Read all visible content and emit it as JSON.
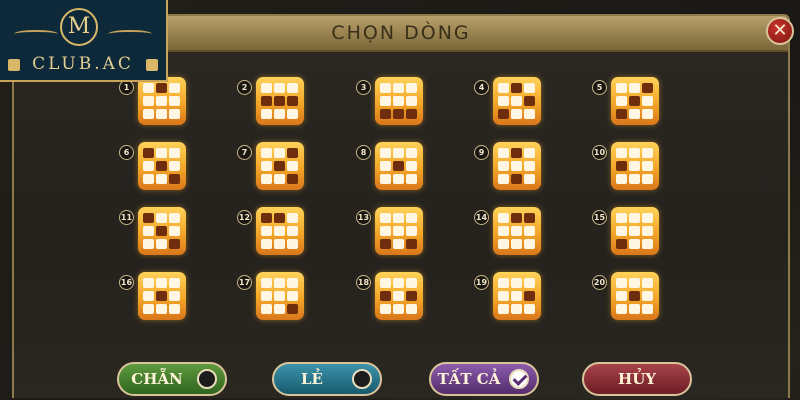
{
  "logo": {
    "monogram": "M",
    "brand": "CLUB.AC"
  },
  "dialog": {
    "title": "CHỌN DÒNG",
    "close_label": "✕"
  },
  "lines": [
    {
      "number": "1",
      "pattern": [
        1,
        0,
        1,
        1,
        1,
        1,
        1,
        1,
        1
      ]
    },
    {
      "number": "2",
      "pattern": [
        1,
        1,
        1,
        0,
        0,
        0,
        1,
        1,
        1
      ]
    },
    {
      "number": "3",
      "pattern": [
        1,
        1,
        1,
        1,
        1,
        1,
        0,
        0,
        0
      ]
    },
    {
      "number": "4",
      "pattern": [
        1,
        0,
        1,
        1,
        1,
        0,
        0,
        1,
        1
      ]
    },
    {
      "number": "5",
      "pattern": [
        1,
        1,
        0,
        1,
        0,
        1,
        0,
        1,
        1
      ]
    },
    {
      "number": "6",
      "pattern": [
        0,
        1,
        1,
        1,
        0,
        1,
        1,
        1,
        0
      ]
    },
    {
      "number": "7",
      "pattern": [
        1,
        1,
        0,
        1,
        0,
        1,
        1,
        1,
        0
      ]
    },
    {
      "number": "8",
      "pattern": [
        1,
        1,
        1,
        1,
        0,
        1,
        1,
        1,
        1
      ]
    },
    {
      "number": "9",
      "pattern": [
        1,
        0,
        1,
        1,
        1,
        1,
        1,
        0,
        1
      ]
    },
    {
      "number": "10",
      "pattern": [
        1,
        1,
        1,
        0,
        1,
        1,
        1,
        1,
        1
      ]
    },
    {
      "number": "11",
      "pattern": [
        0,
        1,
        1,
        1,
        0,
        1,
        1,
        1,
        0
      ]
    },
    {
      "number": "12",
      "pattern": [
        0,
        0,
        1,
        1,
        1,
        1,
        1,
        1,
        1
      ]
    },
    {
      "number": "13",
      "pattern": [
        1,
        1,
        1,
        1,
        1,
        1,
        0,
        1,
        0
      ]
    },
    {
      "number": "14",
      "pattern": [
        1,
        0,
        0,
        1,
        1,
        1,
        1,
        1,
        1
      ]
    },
    {
      "number": "15",
      "pattern": [
        1,
        1,
        1,
        1,
        1,
        1,
        0,
        1,
        1
      ]
    },
    {
      "number": "16",
      "pattern": [
        1,
        1,
        1,
        1,
        0,
        1,
        1,
        1,
        1
      ]
    },
    {
      "number": "17",
      "pattern": [
        1,
        1,
        1,
        1,
        1,
        1,
        1,
        1,
        0
      ]
    },
    {
      "number": "18",
      "pattern": [
        1,
        1,
        1,
        0,
        1,
        0,
        1,
        1,
        1
      ]
    },
    {
      "number": "19",
      "pattern": [
        1,
        1,
        1,
        1,
        1,
        0,
        1,
        1,
        1
      ]
    },
    {
      "number": "20",
      "pattern": [
        1,
        1,
        1,
        1,
        0,
        1,
        1,
        1,
        1
      ]
    }
  ],
  "buttons": {
    "even": {
      "label": "CHẴN",
      "color": "#3f7a2a"
    },
    "odd": {
      "label": "LẺ",
      "color": "#1f6f86"
    },
    "all": {
      "label": "TẤT CẢ",
      "color": "#6a3b86",
      "checked": true
    },
    "cancel": {
      "label": "HỦY",
      "color": "#8a2c33"
    }
  }
}
